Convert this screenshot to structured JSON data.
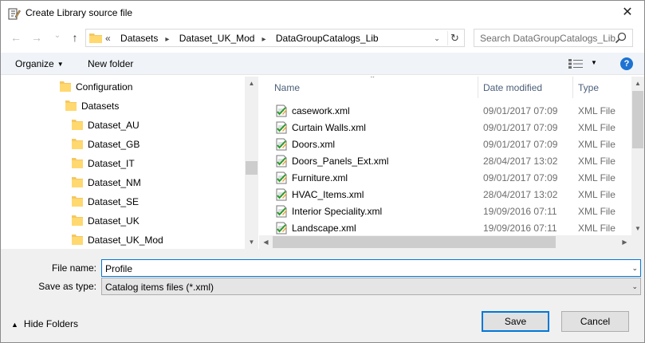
{
  "window": {
    "title": "Create Library source file",
    "close_glyph": "✕"
  },
  "nav": {
    "back_glyph": "←",
    "forward_glyph": "→",
    "recent_glyph": "⌄",
    "up_glyph": "↑",
    "overflow": "«",
    "breadcrumbs": [
      "Datasets",
      "Dataset_UK_Mod",
      "DataGroupCatalogs_Lib"
    ],
    "refresh_glyph": "↻"
  },
  "search": {
    "placeholder": "Search DataGroupCatalogs_Lib"
  },
  "toolbar": {
    "organize": "Organize",
    "new_folder": "New folder",
    "help": "?"
  },
  "tree": {
    "items": [
      {
        "label": "Configuration"
      },
      {
        "label": "Datasets"
      },
      {
        "label": "Dataset_AU"
      },
      {
        "label": "Dataset_GB"
      },
      {
        "label": "Dataset_IT"
      },
      {
        "label": "Dataset_NM"
      },
      {
        "label": "Dataset_SE"
      },
      {
        "label": "Dataset_UK"
      },
      {
        "label": "Dataset_UK_Mod"
      }
    ]
  },
  "list": {
    "columns": {
      "name": "Name",
      "date": "Date modified",
      "type": "Type"
    },
    "files": [
      {
        "name": "casework.xml",
        "date": "09/01/2017 07:09",
        "type": "XML File"
      },
      {
        "name": "Curtain Walls.xml",
        "date": "09/01/2017 07:09",
        "type": "XML File"
      },
      {
        "name": "Doors.xml",
        "date": "09/01/2017 07:09",
        "type": "XML File"
      },
      {
        "name": "Doors_Panels_Ext.xml",
        "date": "28/04/2017 13:02",
        "type": "XML File"
      },
      {
        "name": "Furniture.xml",
        "date": "09/01/2017 07:09",
        "type": "XML File"
      },
      {
        "name": "HVAC_Items.xml",
        "date": "28/04/2017 13:02",
        "type": "XML File"
      },
      {
        "name": "Interior Speciality.xml",
        "date": "19/09/2016 07:11",
        "type": "XML File"
      },
      {
        "name": "Landscape.xml",
        "date": "19/09/2016 07:11",
        "type": "XML File"
      }
    ]
  },
  "form": {
    "file_name_label": "File name:",
    "file_name_value": "Profile",
    "save_type_label": "Save as type:",
    "save_type_value": "Catalog items files (*.xml)"
  },
  "footer": {
    "hide_folders": "Hide Folders",
    "save": "Save",
    "cancel": "Cancel"
  }
}
